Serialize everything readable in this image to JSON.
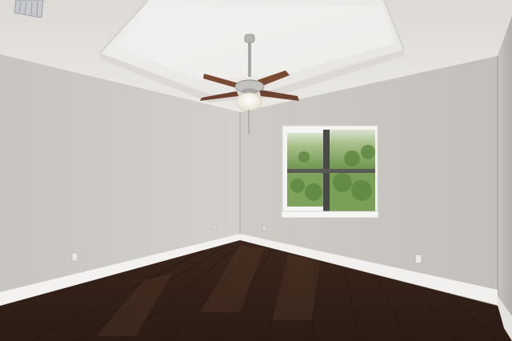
{
  "scene": {
    "subject": "empty room",
    "colors": {
      "ceiling": "#e9e7e4",
      "tray_ceiling": "#f2f1ef",
      "wall_left": "#cdcac6",
      "wall_back": "#c5c1bc",
      "wall_right": "#bdb9b4",
      "baseboard": "#f3f2f0",
      "floor_dark": "#2a1b14",
      "floor_mid": "#3d281d",
      "window_frame": "#f4f4f2",
      "foliage": "#7e9e5c",
      "fan_blade": "#7a4a33",
      "fan_metal": "#b8b6b2"
    }
  }
}
